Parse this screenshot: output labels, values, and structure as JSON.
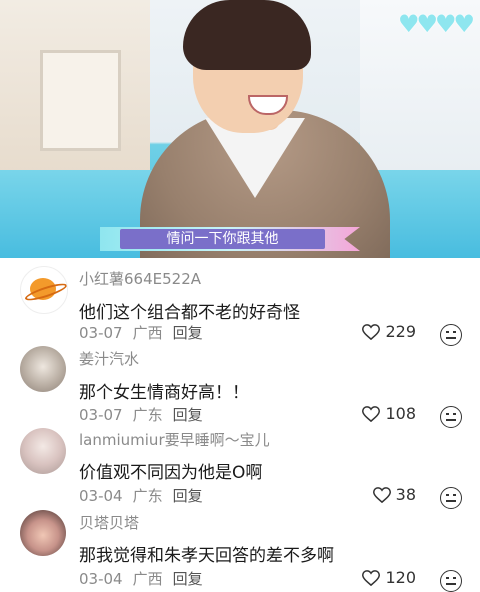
{
  "video": {
    "caption": "情问一下你跟其他",
    "hearts_icon": "hearts-icon"
  },
  "comments": [
    {
      "username": "小红薯664E522A",
      "text": "他们这个组合都不老的好奇怪",
      "date": "03-07",
      "location": "广西",
      "reply": "回复",
      "likes": "229"
    },
    {
      "username": "姜汁汽水",
      "text": "那个女生情商好高！！",
      "date": "03-07",
      "location": "广东",
      "reply": "回复",
      "likes": "108"
    },
    {
      "username": "lanmiumiur要早睡啊～宝儿",
      "text": "价值观不同因为他是O啊",
      "date": "03-04",
      "location": "广东",
      "reply": "回复",
      "likes": "38"
    },
    {
      "username": "贝塔贝塔",
      "text": "那我觉得和朱孝天回答的差不多啊",
      "date": "03-04",
      "location": "广西",
      "reply": "回复",
      "likes": "120"
    }
  ],
  "colors": {
    "accent_caption": "#7a6fc9",
    "meta": "#8a8a8a",
    "text": "#1a1a1a"
  }
}
